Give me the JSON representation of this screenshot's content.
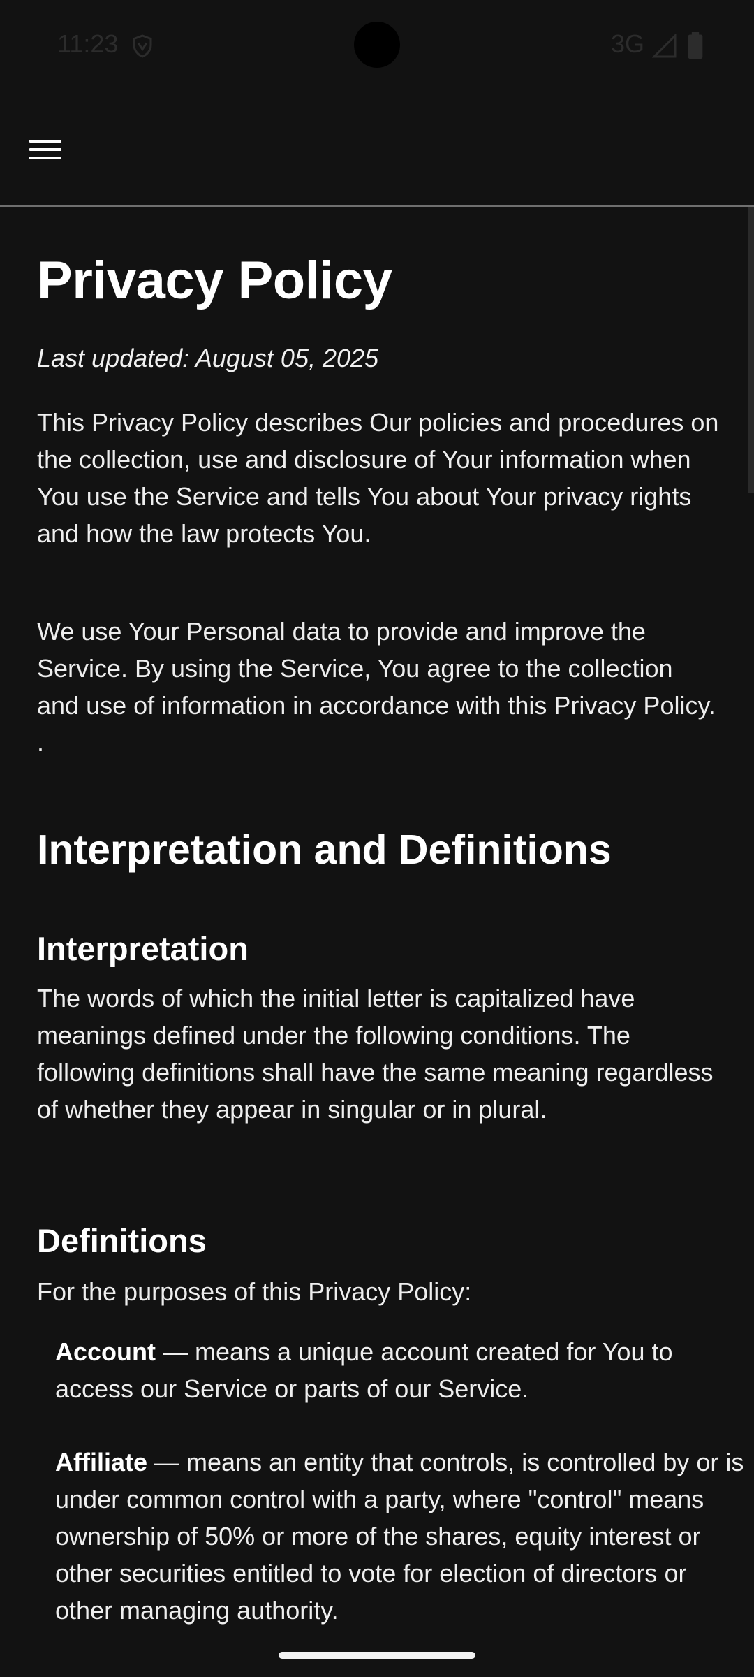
{
  "status_bar": {
    "time": "11:23",
    "network": "3G",
    "icons": [
      "shield-icon",
      "signal-icon",
      "battery-icon"
    ]
  },
  "app_bar": {
    "menu_icon": "hamburger-menu-icon"
  },
  "page": {
    "title": "Privacy Policy",
    "last_updated": "Last updated: August 05, 2025",
    "intro_paragraphs": [
      "This Privacy Policy describes Our policies and procedures on the collection, use and disclosure of Your information when You use the Service and tells You about Your privacy rights and how the law protects You.",
      "We use Your Personal data to provide and improve the Service. By using the Service, You agree to the collection and use of information in accordance with this Privacy Policy. ."
    ],
    "section_heading": "Interpretation and Definitions",
    "interpretation": {
      "heading": "Interpretation",
      "text": "The words of which the initial letter is capitalized have meanings defined under the following conditions. The following definitions shall have the same meaning regardless of whether they appear in singular or in plural."
    },
    "definitions": {
      "heading": "Definitions",
      "intro": "For the purposes of this Privacy Policy:",
      "items": [
        {
          "term": "Account",
          "text": " — means a unique account created for You to access our Service or parts of our Service."
        },
        {
          "term": "Affiliate",
          "text": " — means an entity that controls, is controlled by or is under common control with a party, where \"control\" means ownership of 50% or more of the shares, equity interest or other securities entitled to vote for election of directors or other managing authority."
        }
      ]
    }
  },
  "colors": {
    "background": "#121212",
    "text": "#f2f2f2",
    "divider": "#6f6f6f"
  }
}
